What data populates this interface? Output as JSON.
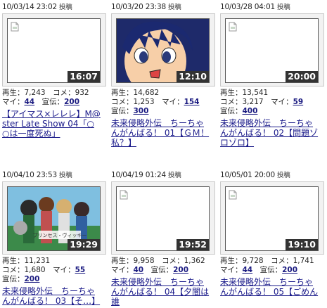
{
  "tag": "投稿",
  "labels": {
    "views": "再生",
    "comments": "コメ",
    "mylist": "マイ",
    "ads": "宣伝"
  },
  "cards": [
    {
      "date": "10/03/14 23:02",
      "duration": "16:07",
      "views": "7,243",
      "comments": "932",
      "mylist": "44",
      "ads": "200",
      "title": "【アイマス×レレレ】M@ster Late Show 04「○○は一度死ぬ」"
    },
    {
      "date": "10/03/20 23:38",
      "duration": "12:10",
      "views": "14,682",
      "comments": "1,253",
      "mylist": "154",
      "ads": "300",
      "title": "未来侵略外伝　ちーちゃんがんばる！ 01【ＧＭ！私？】"
    },
    {
      "date": "10/03/28 04:01",
      "duration": "20:00",
      "views": "13,541",
      "comments": "3,217",
      "mylist": "59",
      "ads": "400",
      "title": "未来侵略外伝　ちーちゃんがんばる！ 02【問題ゾロゾロ】"
    },
    {
      "date": "10/04/10 23:53",
      "duration": "19:29",
      "views": "11,231",
      "comments": "1,680",
      "mylist": "55",
      "ads": "200",
      "title": "未来侵略外伝　ちーちゃんがんばる！ 03【そ…】",
      "thumb_caption": "プリンセス・ヴィッキー"
    },
    {
      "date": "10/04/19 01:24",
      "duration": "19:52",
      "views": "9,958",
      "comments": "1,362",
      "mylist": "40",
      "ads": "200",
      "title": "未来侵略外伝　ちーちゃんがんばる！ 04【夕闇は誰"
    },
    {
      "date": "10/05/01 20:00",
      "duration": "19:10",
      "views": "9,728",
      "comments": "1,741",
      "mylist": "44",
      "ads": "200",
      "title": "未来侵略外伝　ちーちゃんがんばる！ 05【ごめん"
    }
  ],
  "colors": {
    "link": "#1a1a8a",
    "duration_bg": "#333333",
    "thumb_border": "#555555"
  }
}
